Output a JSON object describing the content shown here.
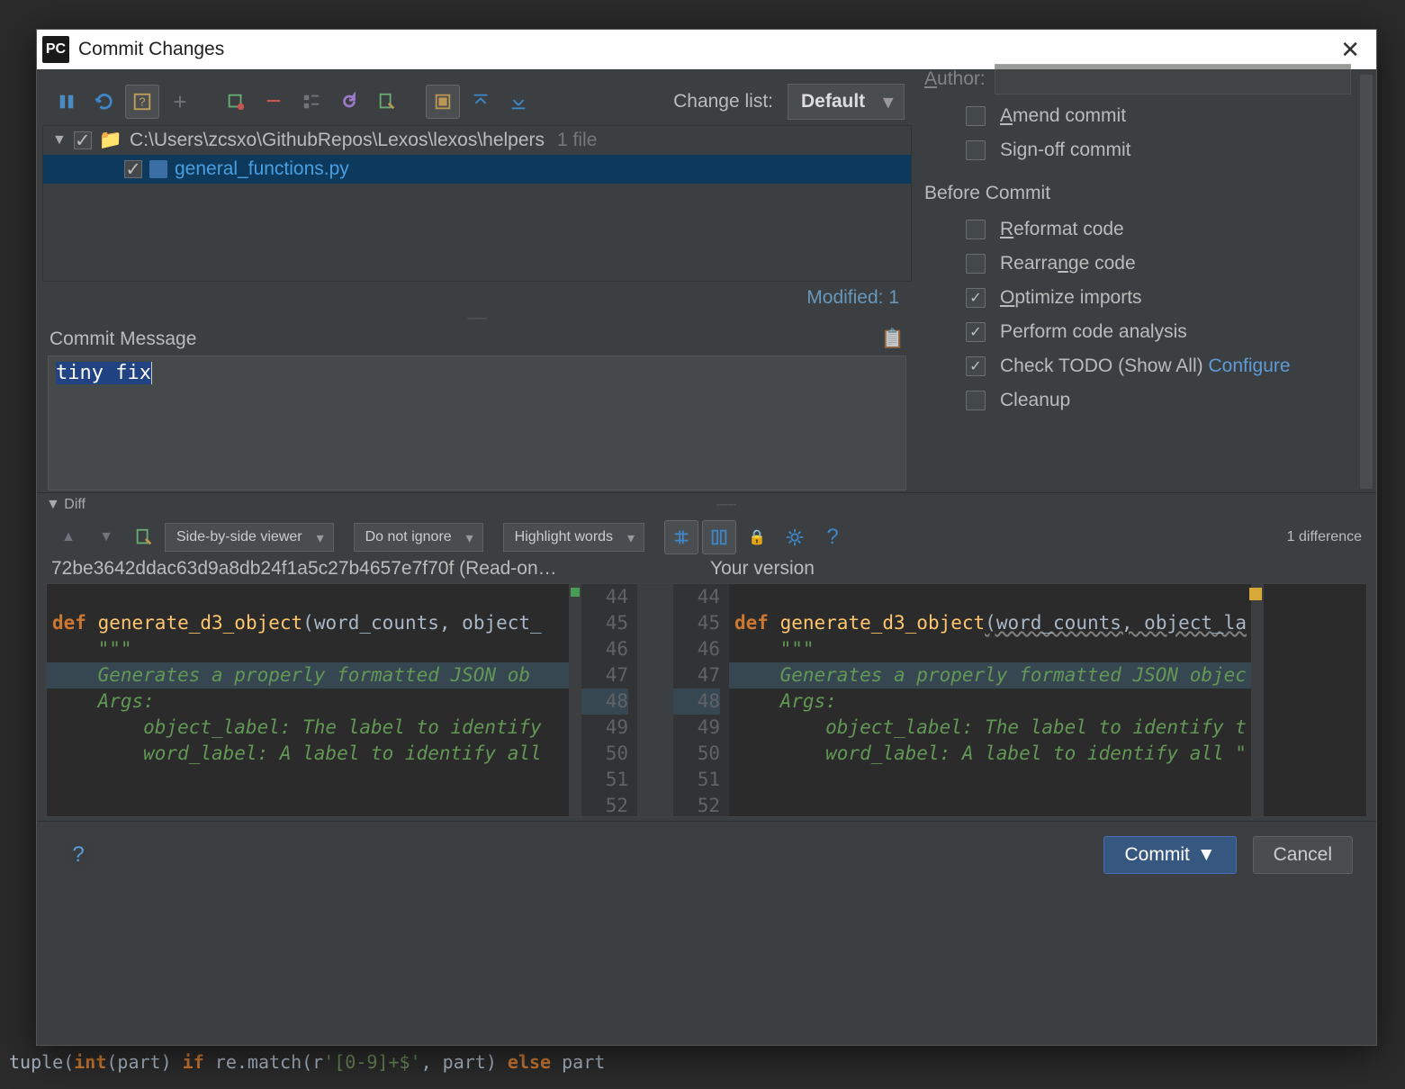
{
  "window": {
    "title": "Commit Changes"
  },
  "toolbar": {
    "change_list_label": "Change list:",
    "change_list_value": "Default"
  },
  "tree": {
    "root_path": "C:\\Users\\zcsxo\\GithubRepos\\Lexos\\lexos\\helpers",
    "root_count": "1 file",
    "file_name": "general_functions.py"
  },
  "modified_status": "Modified: 1",
  "commit_message": {
    "label": "Commit Message",
    "value": "tiny fix"
  },
  "right": {
    "author_label": "Author:",
    "amend": "Amend commit",
    "signoff": "Sign-off commit",
    "before_commit_header": "Before Commit",
    "reformat": "Reformat code",
    "rearrange": "Rearrange code",
    "optimize": "Optimize imports",
    "analysis": "Perform code analysis",
    "todo": "Check TODO (Show All)",
    "configure": "Configure",
    "cleanup": "Cleanup"
  },
  "diff": {
    "collapse_label": "Diff",
    "viewer_mode": "Side-by-side viewer",
    "ignore_mode": "Do not ignore",
    "highlight_mode": "Highlight words",
    "count": "1 difference",
    "left_title": "72be3642ddac63d9a8db24f1a5c27b4657e7f70f (Read-on…",
    "right_title": "Your version",
    "line_numbers": [
      "44",
      "45",
      "46",
      "47",
      "48",
      "49",
      "50",
      "51",
      "52"
    ],
    "code": {
      "def": "def",
      "func": "generate_d3_object",
      "params_left": "(word_counts, object_",
      "params_right": "(word_counts, object_la",
      "docopen": "    \"\"\"",
      "doc_line_left": "    Generates a properly formatted JSON ob",
      "doc_line_right": "    Generates a properly formatted JSON objec",
      "blank": "",
      "args": "    Args:",
      "p1_left": "        object_label: The label to identify",
      "p1_right": "        object_label: The label to identify t",
      "p2_left": "        word_label: A label to identify all",
      "p2_right": "        word_label: A label to identify all \""
    }
  },
  "footer": {
    "commit": "Commit",
    "cancel": "Cancel"
  },
  "backdrop": {
    "tuple_line_a": "tuple(",
    "tuple_line_b": "int",
    "tuple_line_c": "(part) ",
    "tuple_line_d": "if",
    "tuple_line_e": " re.match(r",
    "tuple_line_f": "'[0-9]+$'",
    "tuple_line_g": ", part) ",
    "tuple_line_h": "else",
    "tuple_line_i": " part"
  }
}
